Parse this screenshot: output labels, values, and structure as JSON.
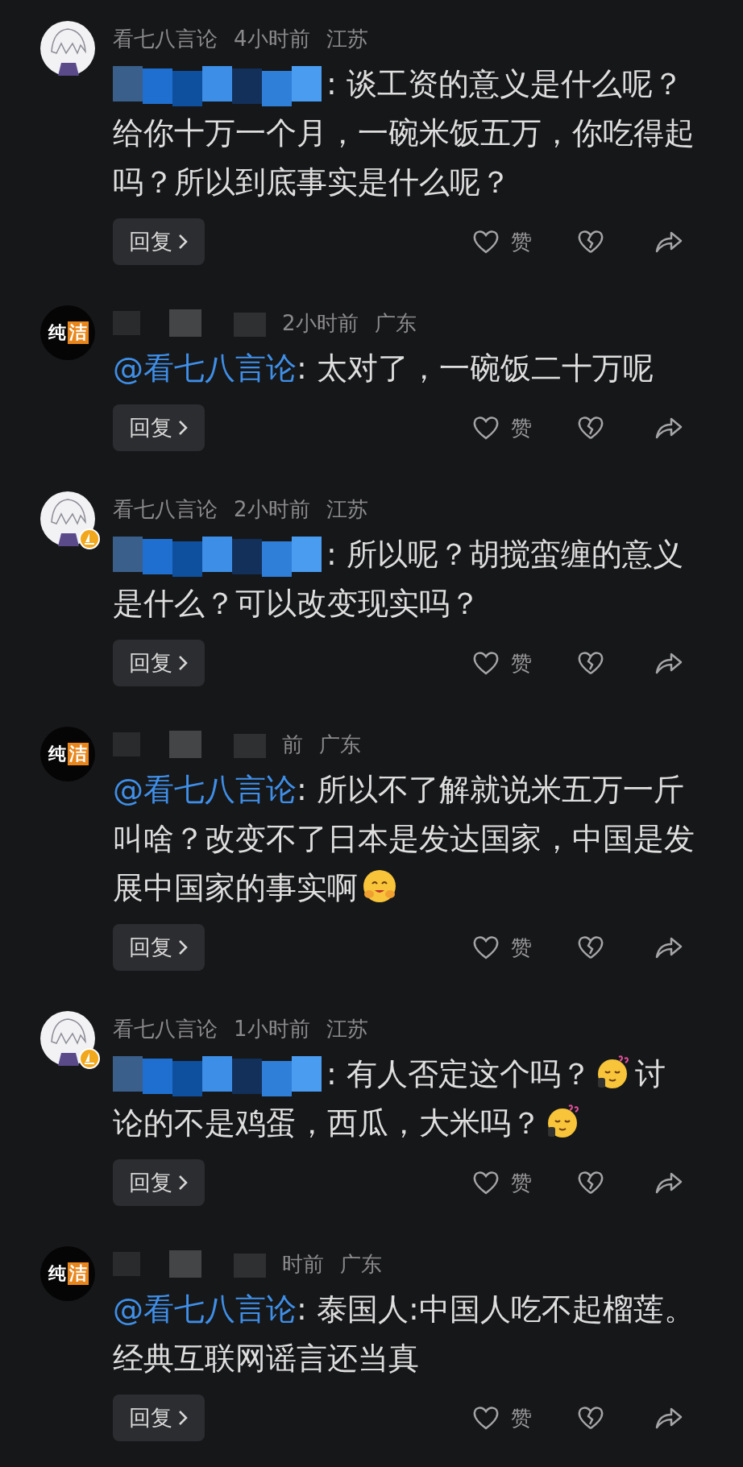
{
  "comments": [
    {
      "avatar": {
        "kind": "anime",
        "badge": false
      },
      "meta": {
        "username": "看七八言论",
        "time": "4小时前",
        "location": "江苏"
      },
      "body": [
        {
          "kind": "mosaic"
        },
        {
          "kind": "text",
          "text": ": 谈工资的意义是什么呢？给你十万一个月，一碗米饭五万，你吃得起吗？所以到底事实是什么呢？"
        }
      ],
      "reply": "回复",
      "like": "赞"
    },
    {
      "avatar": {
        "kind": "text",
        "chars": [
          "纯",
          "洁"
        ]
      },
      "meta": {
        "time": "2小时前",
        "location": "广东"
      },
      "body": [
        {
          "kind": "mention",
          "text": "@看七八言论"
        },
        {
          "kind": "text",
          "text": ": 太对了，一碗饭二十万呢"
        }
      ],
      "reply": "回复",
      "like": "赞"
    },
    {
      "avatar": {
        "kind": "anime",
        "badge": true
      },
      "meta": {
        "username": "看七八言论",
        "time": "2小时前",
        "location": "江苏"
      },
      "body": [
        {
          "kind": "mosaic"
        },
        {
          "kind": "text",
          "text": ": 所以呢？胡搅蛮缠的意义是什么？可以改变现实吗？"
        }
      ],
      "reply": "回复",
      "like": "赞"
    },
    {
      "avatar": {
        "kind": "text",
        "chars": [
          "纯",
          "洁"
        ]
      },
      "meta": {
        "time": "前",
        "location": "广东"
      },
      "body": [
        {
          "kind": "mention",
          "text": "@看七八言论"
        },
        {
          "kind": "text",
          "text": ": 所以不了解就说米五万一斤叫啥？改变不了日本是发达国家，中国是发展中国家的事实啊"
        },
        {
          "kind": "emoji"
        }
      ],
      "reply": "回复",
      "like": "赞"
    },
    {
      "avatar": {
        "kind": "anime",
        "badge": true
      },
      "meta": {
        "username": "看七八言论",
        "time": "1小时前",
        "location": "江苏"
      },
      "body": [
        {
          "kind": "mosaic"
        },
        {
          "kind": "text",
          "text": ": 有人否定这个吗？"
        },
        {
          "kind": "emoji"
        },
        {
          "kind": "text",
          "text": "讨论的不是鸡蛋，西瓜，大米吗？"
        },
        {
          "kind": "emoji"
        }
      ],
      "reply": "回复",
      "like": "赞"
    },
    {
      "avatar": {
        "kind": "text",
        "chars": [
          "纯",
          "洁"
        ]
      },
      "meta": {
        "time": "时前",
        "location": "广东"
      },
      "body": [
        {
          "kind": "mention",
          "text": "@看七八言论"
        },
        {
          "kind": "text",
          "text": ": 泰国人:中国人吃不起榴莲。经典互联网谣言还当真"
        }
      ],
      "reply": "回复",
      "like": "赞"
    }
  ]
}
